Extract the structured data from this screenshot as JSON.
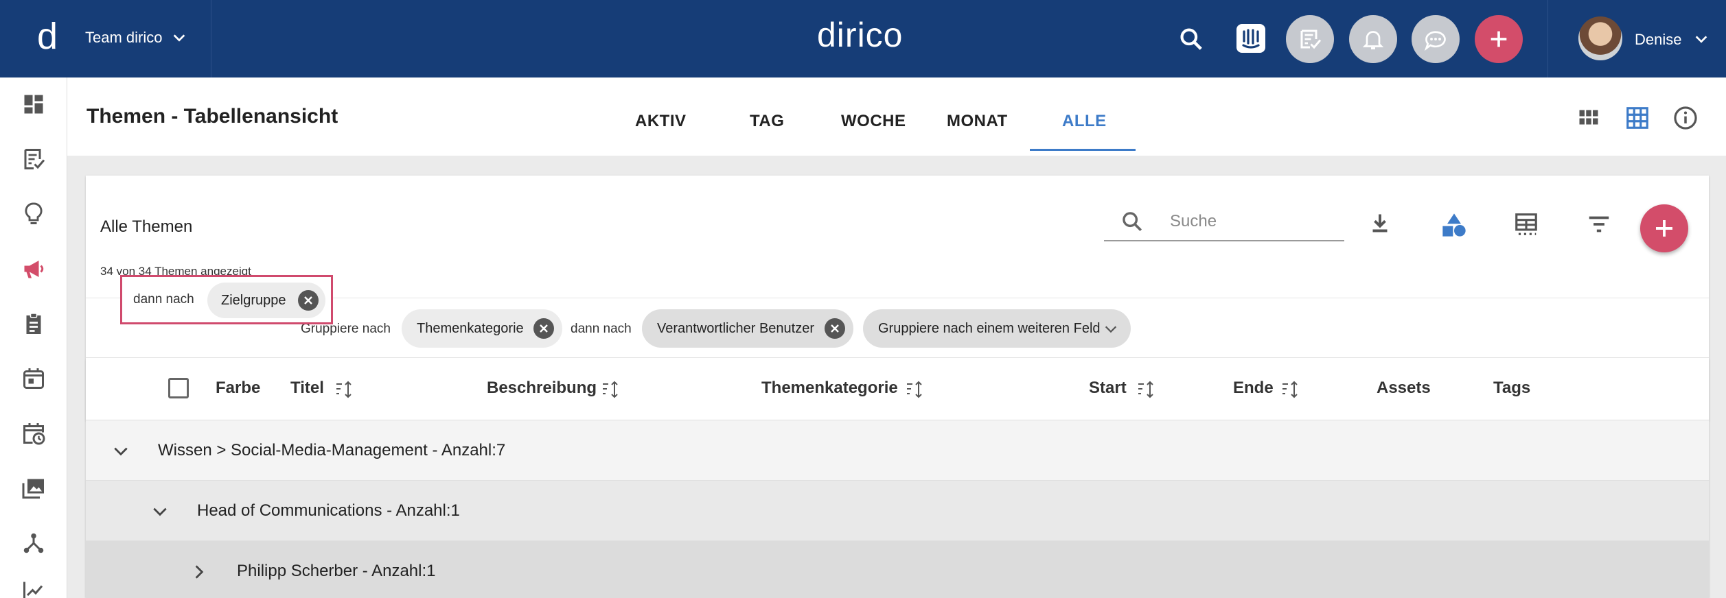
{
  "header": {
    "logo": "d",
    "team": "Team dirico",
    "brand": "dirico",
    "user": "Denise",
    "icons": [
      "search-icon",
      "intercom-icon",
      "tasks-icon",
      "bell-icon",
      "chat-icon",
      "add-icon"
    ]
  },
  "sidebar": {
    "items": [
      "dashboard-icon",
      "tasks-icon",
      "ideas-icon",
      "campaign-icon",
      "clipboard-icon",
      "calendar-icon",
      "schedule-icon",
      "media-icon",
      "network-icon",
      "analytics-icon"
    ]
  },
  "page": {
    "title": "Themen - Tabellenansicht",
    "tabs": [
      {
        "label": "AKTIV"
      },
      {
        "label": "TAG"
      },
      {
        "label": "WOCHE"
      },
      {
        "label": "MONAT"
      },
      {
        "label": "ALLE",
        "active": true
      }
    ]
  },
  "card": {
    "title": "Alle Themen",
    "search_placeholder": "Suche",
    "count_text": "34 von 34 Themen angezeigt"
  },
  "grouping": {
    "label_group_by": "Gruppiere nach",
    "chip1": "Themenkategorie",
    "label_then_1": "dann nach",
    "chip2": "Verantwortlicher Benutzer",
    "chip_add": "Gruppiere nach einem weiteren Feld",
    "highlight_label": "dann nach",
    "highlight_chip": "Zielgruppe"
  },
  "table": {
    "columns": [
      "Farbe",
      "Titel",
      "Beschreibung",
      "Themenkategorie",
      "Start",
      "Ende",
      "Assets",
      "Tags"
    ]
  },
  "groups": [
    {
      "label": "Wissen > Social-Media-Management  -  Anzahl:7",
      "level": 0,
      "expanded": true
    },
    {
      "label": "Head of Communications  -  Anzahl:1",
      "level": 1,
      "expanded": true
    },
    {
      "label": "Philipp Scherber  -  Anzahl:1",
      "level": 2,
      "expanded": false
    }
  ],
  "colors": {
    "topbar": "#163d77",
    "accent_blue": "#3d7bc8",
    "accent_red": "#d34d6a"
  }
}
